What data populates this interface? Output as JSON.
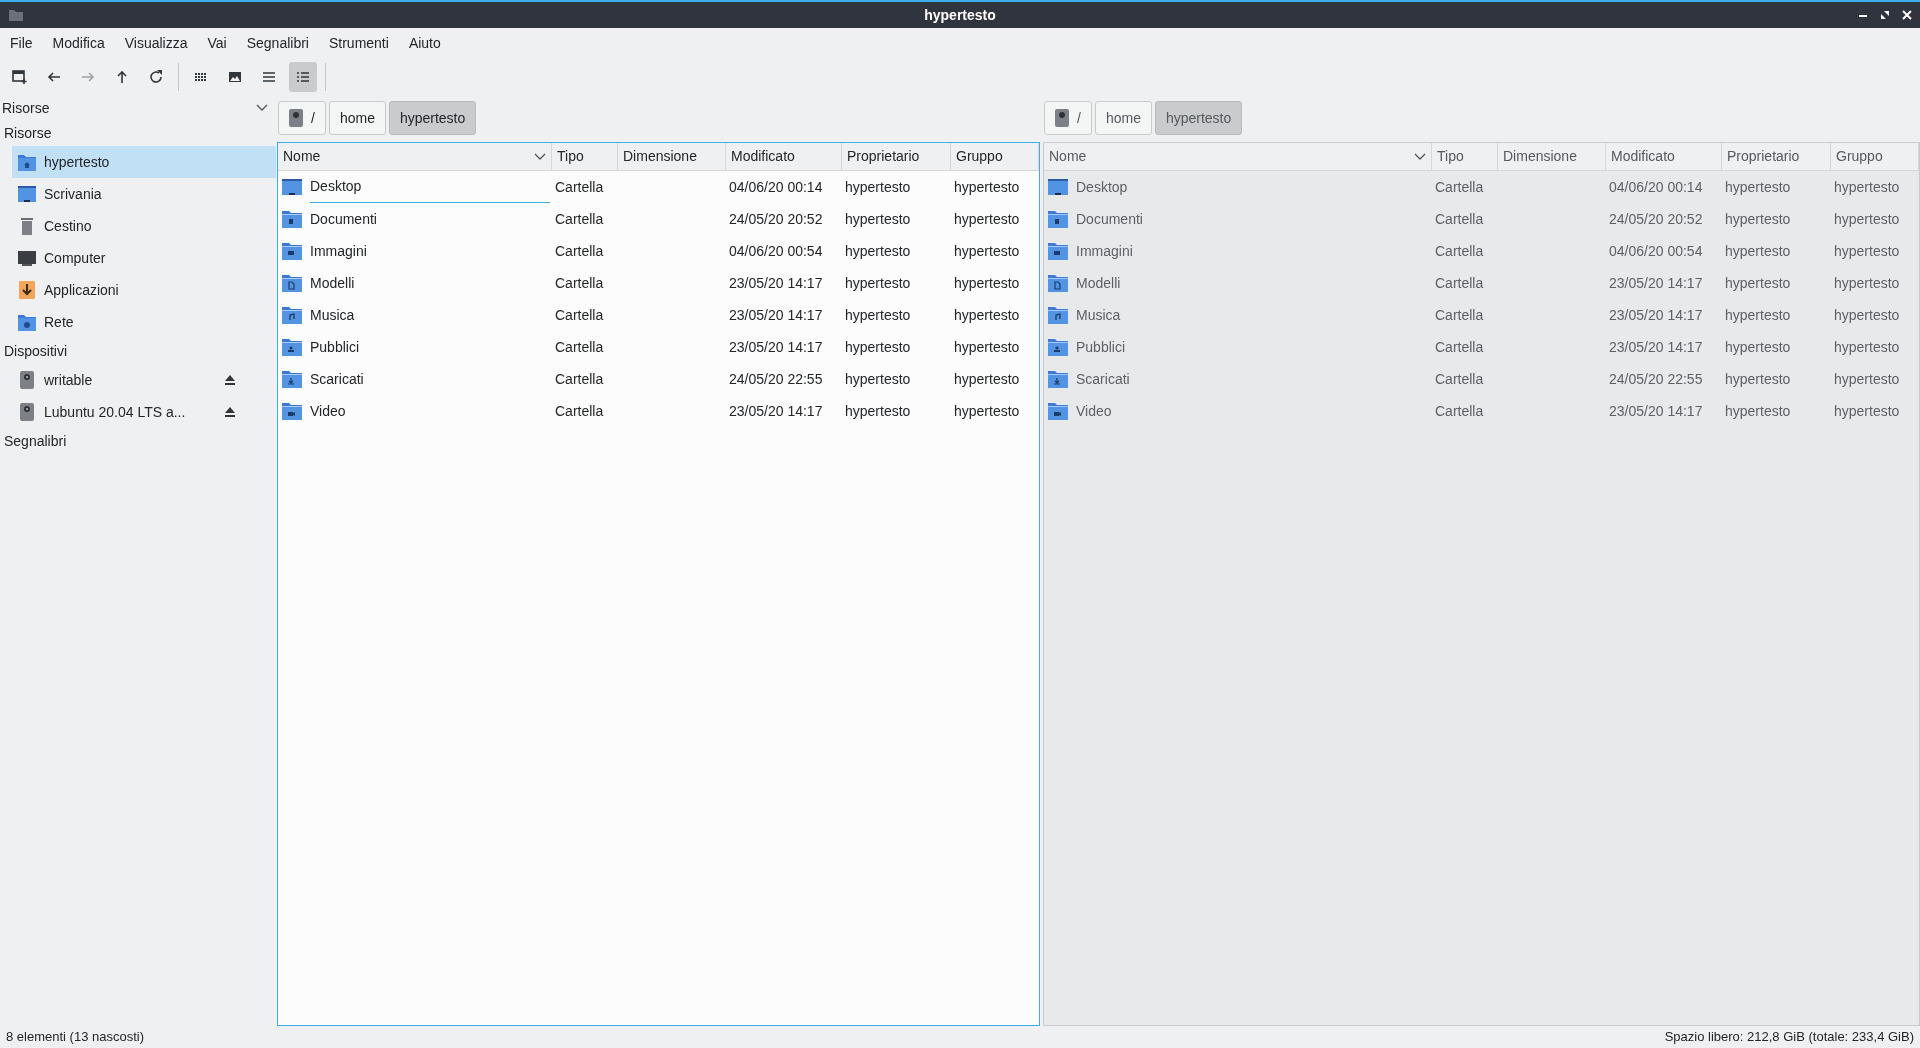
{
  "window": {
    "title": "hypertesto"
  },
  "menu": [
    "File",
    "Modifica",
    "Visualizza",
    "Vai",
    "Segnalibri",
    "Strumenti",
    "Aiuto"
  ],
  "toolbar": [
    {
      "kind": "new-tab",
      "selected": false,
      "disabled": false
    },
    {
      "kind": "back",
      "selected": false,
      "disabled": false
    },
    {
      "kind": "forward",
      "selected": false,
      "disabled": true
    },
    {
      "kind": "up",
      "selected": false,
      "disabled": false
    },
    {
      "kind": "reload",
      "selected": false,
      "disabled": false
    },
    {
      "kind": "sep"
    },
    {
      "kind": "icons",
      "selected": false,
      "disabled": false
    },
    {
      "kind": "thumbs",
      "selected": false,
      "disabled": false
    },
    {
      "kind": "compact",
      "selected": false,
      "disabled": false
    },
    {
      "kind": "details",
      "selected": true,
      "disabled": false
    }
  ],
  "sidebar": {
    "selector": "Risorse",
    "sections": [
      {
        "title": "Risorse",
        "items": [
          {
            "label": "hypertesto",
            "kind": "home",
            "selected": true
          },
          {
            "label": "Scrivania",
            "kind": "desktop",
            "selected": false
          },
          {
            "label": "Cestino",
            "kind": "trash",
            "selected": false
          },
          {
            "label": "Computer",
            "kind": "computer",
            "selected": false
          },
          {
            "label": "Applicazioni",
            "kind": "apps",
            "selected": false
          },
          {
            "label": "Rete",
            "kind": "network",
            "selected": false
          }
        ]
      },
      {
        "title": "Dispositivi",
        "items": [
          {
            "label": "writable",
            "kind": "drive",
            "selected": false,
            "eject": true
          },
          {
            "label": "Lubuntu 20.04 LTS a...",
            "kind": "drive",
            "selected": false,
            "eject": true
          }
        ]
      },
      {
        "title": "Segnalibri"
      }
    ]
  },
  "panes": [
    {
      "active": true,
      "path": [
        {
          "label": "/",
          "root": true,
          "selected": false
        },
        {
          "label": "home",
          "selected": false
        },
        {
          "label": "hypertesto",
          "selected": true
        }
      ],
      "columns": [
        "Nome",
        "Tipo",
        "Dimensione",
        "Modificato",
        "Proprietario",
        "Gruppo"
      ],
      "rows": [
        {
          "kind": "desktop",
          "name": "Desktop",
          "type": "Cartella",
          "modified": "04/06/20 00:14",
          "owner": "hypertesto",
          "group": "hypertesto",
          "current": true
        },
        {
          "kind": "documents",
          "name": "Documenti",
          "type": "Cartella",
          "modified": "24/05/20 20:52",
          "owner": "hypertesto",
          "group": "hypertesto",
          "current": false
        },
        {
          "kind": "pictures",
          "name": "Immagini",
          "type": "Cartella",
          "modified": "04/06/20 00:54",
          "owner": "hypertesto",
          "group": "hypertesto",
          "current": false
        },
        {
          "kind": "templates",
          "name": "Modelli",
          "type": "Cartella",
          "modified": "23/05/20 14:17",
          "owner": "hypertesto",
          "group": "hypertesto",
          "current": false
        },
        {
          "kind": "music",
          "name": "Musica",
          "type": "Cartella",
          "modified": "23/05/20 14:17",
          "owner": "hypertesto",
          "group": "hypertesto",
          "current": false
        },
        {
          "kind": "public",
          "name": "Pubblici",
          "type": "Cartella",
          "modified": "23/05/20 14:17",
          "owner": "hypertesto",
          "group": "hypertesto",
          "current": false
        },
        {
          "kind": "downloads",
          "name": "Scaricati",
          "type": "Cartella",
          "modified": "24/05/20 22:55",
          "owner": "hypertesto",
          "group": "hypertesto",
          "current": false
        },
        {
          "kind": "video",
          "name": "Video",
          "type": "Cartella",
          "modified": "23/05/20 14:17",
          "owner": "hypertesto",
          "group": "hypertesto",
          "current": false
        }
      ]
    },
    {
      "active": false,
      "path": [
        {
          "label": "/",
          "root": true,
          "selected": false
        },
        {
          "label": "home",
          "selected": false
        },
        {
          "label": "hypertesto",
          "selected": true
        }
      ],
      "columns": [
        "Nome",
        "Tipo",
        "Dimensione",
        "Modificato",
        "Proprietario",
        "Gruppo"
      ],
      "rows": [
        {
          "kind": "desktop",
          "name": "Desktop",
          "type": "Cartella",
          "modified": "04/06/20 00:14",
          "owner": "hypertesto",
          "group": "hypertesto",
          "current": false
        },
        {
          "kind": "documents",
          "name": "Documenti",
          "type": "Cartella",
          "modified": "24/05/20 20:52",
          "owner": "hypertesto",
          "group": "hypertesto",
          "current": false
        },
        {
          "kind": "pictures",
          "name": "Immagini",
          "type": "Cartella",
          "modified": "04/06/20 00:54",
          "owner": "hypertesto",
          "group": "hypertesto",
          "current": false
        },
        {
          "kind": "templates",
          "name": "Modelli",
          "type": "Cartella",
          "modified": "23/05/20 14:17",
          "owner": "hypertesto",
          "group": "hypertesto",
          "current": false
        },
        {
          "kind": "music",
          "name": "Musica",
          "type": "Cartella",
          "modified": "23/05/20 14:17",
          "owner": "hypertesto",
          "group": "hypertesto",
          "current": false
        },
        {
          "kind": "public",
          "name": "Pubblici",
          "type": "Cartella",
          "modified": "23/05/20 14:17",
          "owner": "hypertesto",
          "group": "hypertesto",
          "current": false
        },
        {
          "kind": "downloads",
          "name": "Scaricati",
          "type": "Cartella",
          "modified": "24/05/20 22:55",
          "owner": "hypertesto",
          "group": "hypertesto",
          "current": false
        },
        {
          "kind": "video",
          "name": "Video",
          "type": "Cartella",
          "modified": "23/05/20 14:17",
          "owner": "hypertesto",
          "group": "hypertesto",
          "current": false
        }
      ]
    }
  ],
  "status_bar": {
    "left": "8 elementi (13 nascosti)",
    "right": "Spazio libero: 212,8 GiB (totale: 233,4 GiB)"
  }
}
